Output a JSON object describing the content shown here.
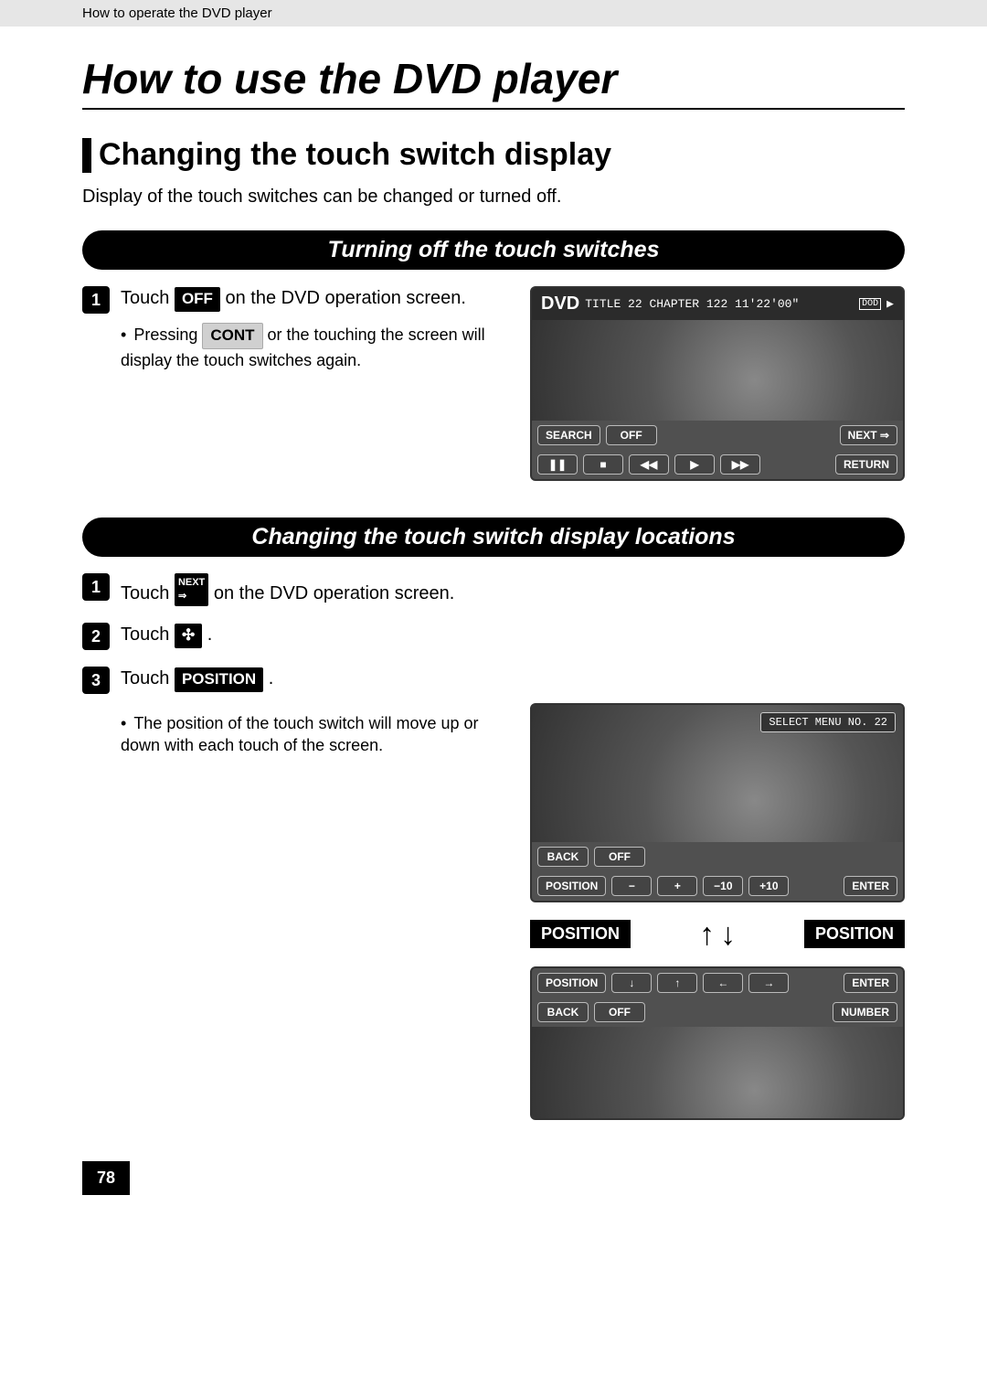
{
  "header_band": "How to operate the DVD player",
  "page_title": "How to use the DVD player",
  "section_title": "Changing the touch switch display",
  "intro_text": "Display of the touch switches can be changed or turned off.",
  "pill1": "Turning off the touch switches",
  "pill2": "Changing the touch switch display locations",
  "step1_1_a": "Touch ",
  "btn_off": "OFF",
  "step1_1_b": " on the DVD operation screen.",
  "note1_a": "Pressing ",
  "btn_cont": "CONT",
  "note1_b": " or the touching the screen will display the touch switches again.",
  "step2_1_a": "Touch ",
  "icon_next_label": "NEXT",
  "step2_1_b": " on the DVD operation screen.",
  "step2_2_a": "Touch ",
  "icon_sparkle": "✣",
  "step2_2_b": " .",
  "step2_3_a": "Touch ",
  "btn_position": "POSITION",
  "step2_3_b": " .",
  "note2": "The position of the touch switch will move up or down with each touch of the screen.",
  "screen1": {
    "dvd": "DVD",
    "status": "TITLE 22 CHAPTER 122  11'22'00\"",
    "dolby": "DOD",
    "btns_row1": [
      "SEARCH",
      "OFF"
    ],
    "btns_row1_right": [
      "NEXT ⇒"
    ],
    "btns_row2": [
      "❚❚",
      "■",
      "◀◀",
      "▶",
      "▶▶",
      "RETURN"
    ]
  },
  "screen2": {
    "select_menu": "SELECT MENU NO. 22",
    "btns_row1": [
      "BACK",
      "OFF"
    ],
    "btns_row2": [
      "POSITION",
      "−",
      "+",
      "−10",
      "+10",
      "ENTER"
    ]
  },
  "pos_label_left": "POSITION",
  "pos_label_right": "POSITION",
  "arrow_up": "↑",
  "arrow_down": "↓",
  "screen3": {
    "row1": [
      "POSITION",
      "↓",
      "↑",
      "←",
      "→",
      "ENTER"
    ],
    "row2": [
      "BACK",
      "OFF"
    ],
    "row2_right": [
      "NUMBER"
    ]
  },
  "page_number": "78"
}
